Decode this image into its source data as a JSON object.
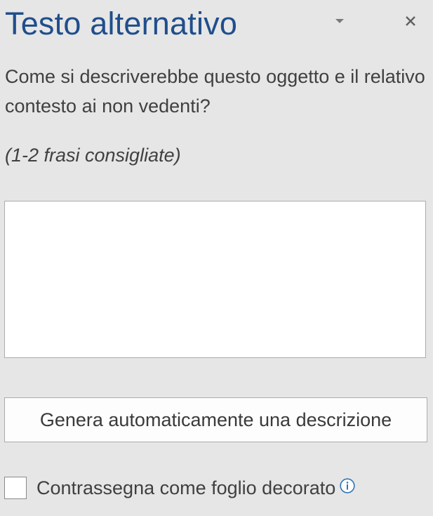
{
  "pane": {
    "title": "Testo alternativo"
  },
  "question": "Come si descriverebbe questo oggetto e il relativo contesto ai non vedenti?",
  "hint": "(1-2 frasi consigliate)",
  "description_input": {
    "value": "",
    "placeholder": ""
  },
  "generate_button_label": "Genera automaticamente una descrizione",
  "decorative": {
    "label": "Contrassegna come foglio decorato",
    "checked": false
  },
  "icons": {
    "dropdown": "chevron-down-icon",
    "close": "close-icon",
    "info": "info-icon"
  },
  "colors": {
    "title": "#1f4e8c",
    "background": "#e6e6e6",
    "info": "#2e75b6"
  }
}
